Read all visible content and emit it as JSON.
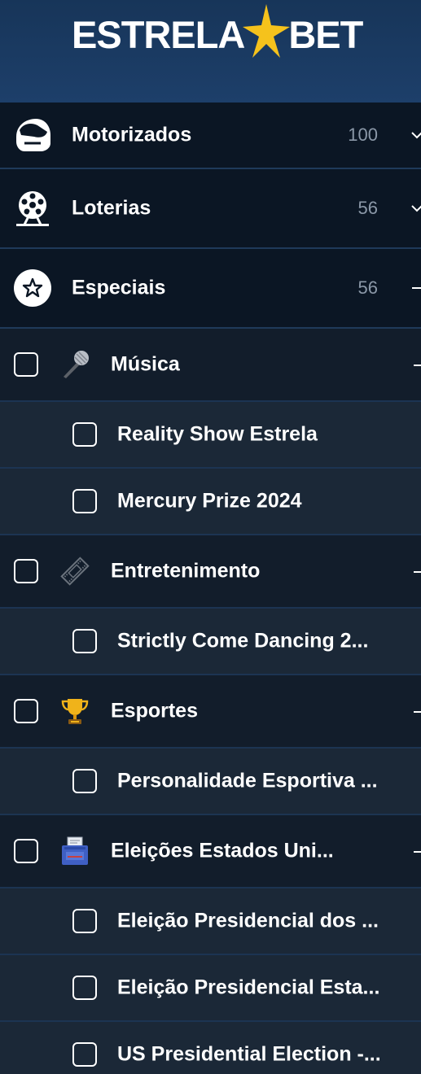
{
  "brand": {
    "left": "ESTRELA",
    "right": "BET",
    "star_color": "#f5c21c"
  },
  "colors": {
    "header_bg": "#1d3f6a",
    "category_bg": "#0b1624",
    "subcategory_bg": "#121d2b",
    "leaf_bg": "#1b2837",
    "divider": "#1f3a5a",
    "count_text": "#8b98a8"
  },
  "categories": [
    {
      "label": "Motorizados",
      "count": "100",
      "icon": "motorcycle-helmet-icon",
      "toggle": "chevron-down-icon"
    },
    {
      "label": "Loterias",
      "count": "56",
      "icon": "lottery-wheel-icon",
      "toggle": "chevron-down-icon"
    },
    {
      "label": "Especiais",
      "count": "56",
      "icon": "star-badge-icon",
      "toggle": "collapse-icon"
    }
  ],
  "subcategories": [
    {
      "label": "Música",
      "icon": "microphone-icon",
      "items": [
        "Reality Show Estrela",
        "Mercury Prize 2024"
      ]
    },
    {
      "label": "Entretenimento",
      "icon": "film-strip-icon",
      "items": [
        "Strictly Come Dancing 2..."
      ]
    },
    {
      "label": "Esportes",
      "icon": "trophy-icon",
      "items": [
        "Personalidade Esportiva ..."
      ]
    },
    {
      "label": "Eleições Estados Uni...",
      "icon": "ballot-box-icon",
      "items": [
        "Eleição Presidencial dos ...",
        "Eleição Presidencial Esta...",
        "US Presidential Election -..."
      ]
    }
  ]
}
